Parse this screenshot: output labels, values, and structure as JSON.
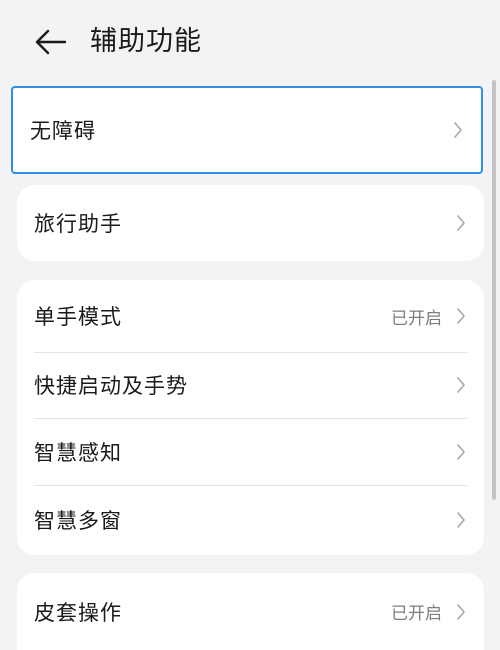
{
  "header": {
    "back_icon": "arrow-left-icon",
    "title": "辅助功能"
  },
  "accent_color": "#2f8fe8",
  "groups": [
    {
      "items": [
        {
          "label": "无障碍",
          "status": "",
          "focused": true
        }
      ]
    },
    {
      "items": [
        {
          "label": "旅行助手",
          "status": ""
        }
      ]
    },
    {
      "items": [
        {
          "label": "单手模式",
          "status": "已开启"
        },
        {
          "label": "快捷启动及手势",
          "status": ""
        },
        {
          "label": "智慧感知",
          "status": ""
        },
        {
          "label": "智慧多窗",
          "status": ""
        }
      ]
    },
    {
      "items": [
        {
          "label": "皮套操作",
          "status": "已开启"
        }
      ]
    }
  ]
}
